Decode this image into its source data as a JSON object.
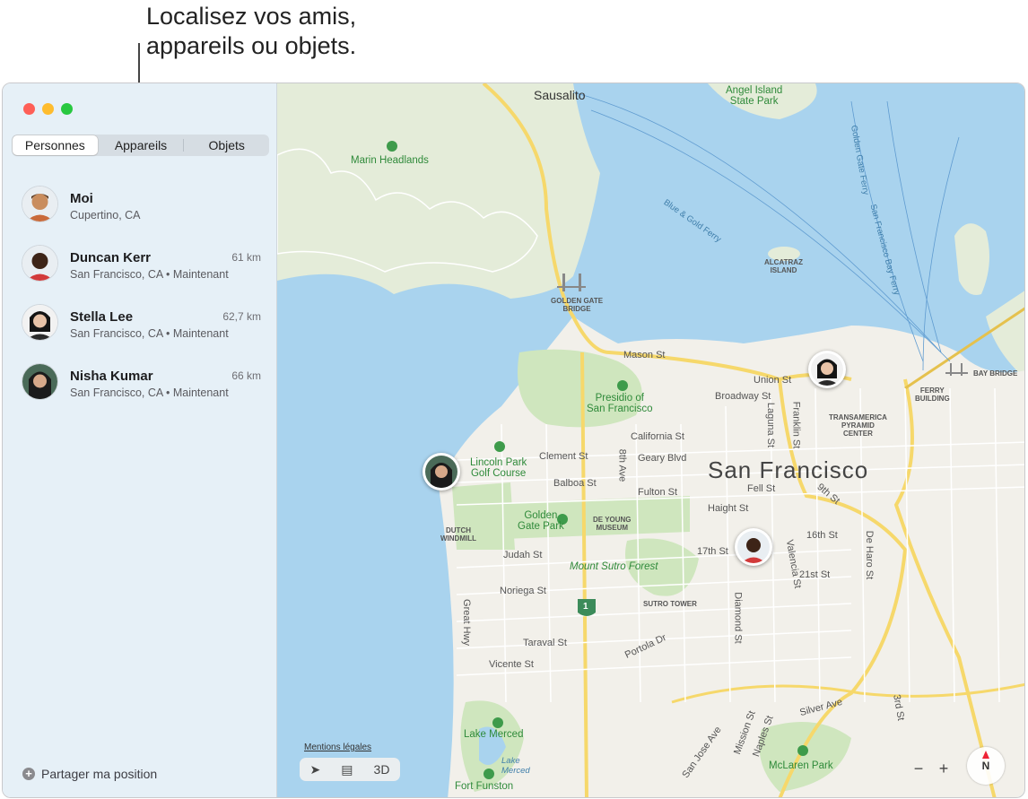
{
  "callout": {
    "line1": "Localisez vos amis,",
    "line2": "appareils ou objets."
  },
  "tabs": {
    "people": "Personnes",
    "devices": "Appareils",
    "items": "Objets"
  },
  "people": [
    {
      "name": "Moi",
      "distance": "",
      "location": "Cupertino, CA"
    },
    {
      "name": "Duncan Kerr",
      "distance": "61 km",
      "location": "San Francisco, CA • Maintenant"
    },
    {
      "name": "Stella Lee",
      "distance": "62,7 km",
      "location": "San Francisco, CA • Maintenant"
    },
    {
      "name": "Nisha Kumar",
      "distance": "66 km",
      "location": "San Francisco, CA • Maintenant"
    }
  ],
  "share_label": "Partager ma position",
  "map": {
    "city": "San Francisco",
    "labels": {
      "sausalito": "Sausalito",
      "angel_island": "Angel Island\nState Park",
      "marin": "Marin Headlands",
      "golden_gate_bridge": "GOLDEN GATE\nBRIDGE",
      "alcatraz": "ALCATRAZ\nISLAND",
      "bay_bridge": "BAY BRIDGE",
      "ferry_building": "FERRY\nBUILDING",
      "transamerica": "TRANSAMERICA\nPYRAMID\nCENTER",
      "presidio": "Presidio of\nSan Francisco",
      "lincoln_park": "Lincoln Park\nGolf Course",
      "golden_gate_park": "Golden\nGate Park",
      "de_young": "DE YOUNG\nMUSEUM",
      "dutch_windmill": "DUTCH\nWINDMILL",
      "mount_sutro": "Mount Sutro Forest",
      "sutro_tower": "SUTRO TOWER",
      "lake_merced": "Lake Merced",
      "lake_merced_water": "Lake\nMerced",
      "fort_funston": "Fort Funston",
      "mclaren": "McLaren Park",
      "ferry1": "Blue & Gold Ferry",
      "ferry2": "Golden Gate Ferry",
      "ferry3": "San Francisco Bay Ferry",
      "mason": "Mason St",
      "union": "Union St",
      "broadway": "Broadway St",
      "california": "California St",
      "clement": "Clement St",
      "geary": "Geary Blvd",
      "balboa": "Balboa St",
      "fulton": "Fulton St",
      "fell": "Fell St",
      "haight": "Haight St",
      "ninth": "9th St",
      "eighth_ave": "8th Ave",
      "laguna": "Laguna St",
      "franklin": "Franklin St",
      "judah": "Judah St",
      "noriega": "Noriega St",
      "taraval": "Taraval St",
      "vicente": "Vicente St",
      "great_hwy": "Great Hwy",
      "seventeenth": "17th St",
      "sixteenth": "16th St",
      "twentyfirst": "21st St",
      "valencia": "Valencia St",
      "de_haro": "De Haro St",
      "diamond": "Diamond St",
      "portola": "Portola Dr",
      "silver": "Silver Ave",
      "third": "3rd St",
      "san_jose": "San Jose Ave",
      "mission": "Mission St",
      "naples": "Naples St",
      "route": "1"
    },
    "legal": "Mentions légales",
    "view_3d": "3D",
    "zoom_out": "−",
    "zoom_in": "+",
    "compass": "N"
  }
}
